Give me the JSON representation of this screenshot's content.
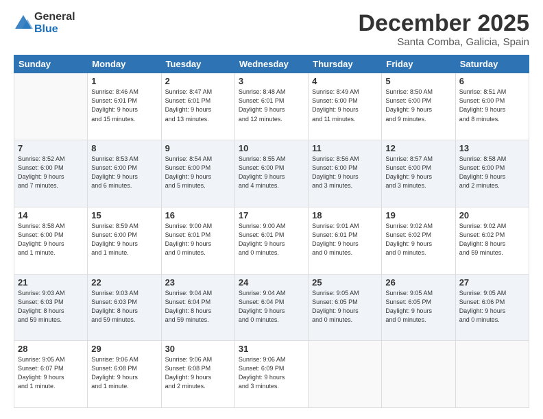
{
  "logo": {
    "general": "General",
    "blue": "Blue"
  },
  "title": "December 2025",
  "location": "Santa Comba, Galicia, Spain",
  "headers": [
    "Sunday",
    "Monday",
    "Tuesday",
    "Wednesday",
    "Thursday",
    "Friday",
    "Saturday"
  ],
  "weeks": [
    [
      {
        "day": "",
        "info": ""
      },
      {
        "day": "1",
        "info": "Sunrise: 8:46 AM\nSunset: 6:01 PM\nDaylight: 9 hours\nand 15 minutes."
      },
      {
        "day": "2",
        "info": "Sunrise: 8:47 AM\nSunset: 6:01 PM\nDaylight: 9 hours\nand 13 minutes."
      },
      {
        "day": "3",
        "info": "Sunrise: 8:48 AM\nSunset: 6:01 PM\nDaylight: 9 hours\nand 12 minutes."
      },
      {
        "day": "4",
        "info": "Sunrise: 8:49 AM\nSunset: 6:00 PM\nDaylight: 9 hours\nand 11 minutes."
      },
      {
        "day": "5",
        "info": "Sunrise: 8:50 AM\nSunset: 6:00 PM\nDaylight: 9 hours\nand 9 minutes."
      },
      {
        "day": "6",
        "info": "Sunrise: 8:51 AM\nSunset: 6:00 PM\nDaylight: 9 hours\nand 8 minutes."
      }
    ],
    [
      {
        "day": "7",
        "info": "Sunrise: 8:52 AM\nSunset: 6:00 PM\nDaylight: 9 hours\nand 7 minutes."
      },
      {
        "day": "8",
        "info": "Sunrise: 8:53 AM\nSunset: 6:00 PM\nDaylight: 9 hours\nand 6 minutes."
      },
      {
        "day": "9",
        "info": "Sunrise: 8:54 AM\nSunset: 6:00 PM\nDaylight: 9 hours\nand 5 minutes."
      },
      {
        "day": "10",
        "info": "Sunrise: 8:55 AM\nSunset: 6:00 PM\nDaylight: 9 hours\nand 4 minutes."
      },
      {
        "day": "11",
        "info": "Sunrise: 8:56 AM\nSunset: 6:00 PM\nDaylight: 9 hours\nand 3 minutes."
      },
      {
        "day": "12",
        "info": "Sunrise: 8:57 AM\nSunset: 6:00 PM\nDaylight: 9 hours\nand 3 minutes."
      },
      {
        "day": "13",
        "info": "Sunrise: 8:58 AM\nSunset: 6:00 PM\nDaylight: 9 hours\nand 2 minutes."
      }
    ],
    [
      {
        "day": "14",
        "info": "Sunrise: 8:58 AM\nSunset: 6:00 PM\nDaylight: 9 hours\nand 1 minute."
      },
      {
        "day": "15",
        "info": "Sunrise: 8:59 AM\nSunset: 6:00 PM\nDaylight: 9 hours\nand 1 minute."
      },
      {
        "day": "16",
        "info": "Sunrise: 9:00 AM\nSunset: 6:01 PM\nDaylight: 9 hours\nand 0 minutes."
      },
      {
        "day": "17",
        "info": "Sunrise: 9:00 AM\nSunset: 6:01 PM\nDaylight: 9 hours\nand 0 minutes."
      },
      {
        "day": "18",
        "info": "Sunrise: 9:01 AM\nSunset: 6:01 PM\nDaylight: 9 hours\nand 0 minutes."
      },
      {
        "day": "19",
        "info": "Sunrise: 9:02 AM\nSunset: 6:02 PM\nDaylight: 9 hours\nand 0 minutes."
      },
      {
        "day": "20",
        "info": "Sunrise: 9:02 AM\nSunset: 6:02 PM\nDaylight: 8 hours\nand 59 minutes."
      }
    ],
    [
      {
        "day": "21",
        "info": "Sunrise: 9:03 AM\nSunset: 6:03 PM\nDaylight: 8 hours\nand 59 minutes."
      },
      {
        "day": "22",
        "info": "Sunrise: 9:03 AM\nSunset: 6:03 PM\nDaylight: 8 hours\nand 59 minutes."
      },
      {
        "day": "23",
        "info": "Sunrise: 9:04 AM\nSunset: 6:04 PM\nDaylight: 8 hours\nand 59 minutes."
      },
      {
        "day": "24",
        "info": "Sunrise: 9:04 AM\nSunset: 6:04 PM\nDaylight: 9 hours\nand 0 minutes."
      },
      {
        "day": "25",
        "info": "Sunrise: 9:05 AM\nSunset: 6:05 PM\nDaylight: 9 hours\nand 0 minutes."
      },
      {
        "day": "26",
        "info": "Sunrise: 9:05 AM\nSunset: 6:05 PM\nDaylight: 9 hours\nand 0 minutes."
      },
      {
        "day": "27",
        "info": "Sunrise: 9:05 AM\nSunset: 6:06 PM\nDaylight: 9 hours\nand 0 minutes."
      }
    ],
    [
      {
        "day": "28",
        "info": "Sunrise: 9:05 AM\nSunset: 6:07 PM\nDaylight: 9 hours\nand 1 minute."
      },
      {
        "day": "29",
        "info": "Sunrise: 9:06 AM\nSunset: 6:08 PM\nDaylight: 9 hours\nand 1 minute."
      },
      {
        "day": "30",
        "info": "Sunrise: 9:06 AM\nSunset: 6:08 PM\nDaylight: 9 hours\nand 2 minutes."
      },
      {
        "day": "31",
        "info": "Sunrise: 9:06 AM\nSunset: 6:09 PM\nDaylight: 9 hours\nand 3 minutes."
      },
      {
        "day": "",
        "info": ""
      },
      {
        "day": "",
        "info": ""
      },
      {
        "day": "",
        "info": ""
      }
    ]
  ]
}
